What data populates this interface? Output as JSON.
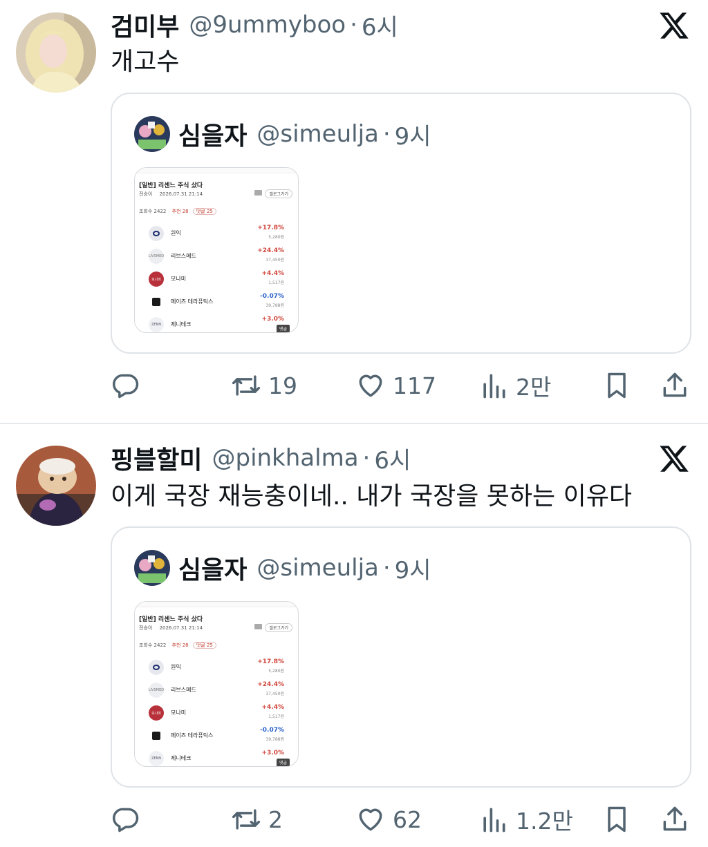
{
  "tweets": [
    {
      "name": "검미부",
      "handle": "@9ummyboo",
      "separator": "·",
      "time": "6시",
      "text": "개고수",
      "avatar_icon": "user-avatar-blonde",
      "quote": {
        "name": "심을자",
        "handle": "@simeulja",
        "separator": "·",
        "time": "9시",
        "avatar_icon": "cartoon-avatar",
        "screenshot": {
          "title": "[일반] 리센느 주식 샀다",
          "author": "전승이",
          "date": "2026.07.31 21:14",
          "copy_button": "갤로그가기",
          "views_label": "조회수 2422",
          "recommend_label": "추천 28",
          "comments_label": "댓글 25",
          "stocks": [
            {
              "name": "원익",
              "change": "+17.8%",
              "price": "5,280원",
              "dir": "up",
              "logo_color": "#1e2f6e",
              "logo_text": ""
            },
            {
              "name": "리브스메드",
              "change": "+24.4%",
              "price": "37,450원",
              "dir": "up",
              "logo_color": "#c9ced6",
              "logo_text": "LIVSMED"
            },
            {
              "name": "모나미",
              "change": "+4.4%",
              "price": "1,517원",
              "dir": "up",
              "logo_color": "#b8313a",
              "logo_text": "모나미"
            },
            {
              "name": "메이즈 테라퓨틱스",
              "change": "-0.07%",
              "price": "39,788원",
              "dir": "down",
              "logo_color": "#1a1a1a",
              "logo_text": ""
            },
            {
              "name": "제니테크",
              "change": "+3.0%",
              "price": "",
              "dir": "up",
              "logo_color": "#dfe3ea",
              "logo_text": "ZENN"
            }
          ],
          "badge": "댓글"
        }
      },
      "actions": {
        "reply": "",
        "retweet": "19",
        "like": "117",
        "views": "2만"
      }
    },
    {
      "name": "핑블할미",
      "handle": "@pinkhalma",
      "separator": "·",
      "time": "6시",
      "text": "이게 국장 재능충이네.. 내가 국장을 못하는 이유다",
      "avatar_icon": "grandma-avatar",
      "quote": {
        "name": "심을자",
        "handle": "@simeulja",
        "separator": "·",
        "time": "9시",
        "avatar_icon": "cartoon-avatar",
        "screenshot": {
          "title": "[일반] 리센느 주식 샀다",
          "author": "전승이",
          "date": "2026.07.31 21:14",
          "copy_button": "갤로그가기",
          "views_label": "조회수 2422",
          "recommend_label": "추천 28",
          "comments_label": "댓글 25",
          "stocks": [
            {
              "name": "원익",
              "change": "+17.8%",
              "price": "5,280원",
              "dir": "up",
              "logo_color": "#1e2f6e",
              "logo_text": ""
            },
            {
              "name": "리브스메드",
              "change": "+24.4%",
              "price": "37,450원",
              "dir": "up",
              "logo_color": "#c9ced6",
              "logo_text": "LIVSMED"
            },
            {
              "name": "모나미",
              "change": "+4.4%",
              "price": "1,517원",
              "dir": "up",
              "logo_color": "#b8313a",
              "logo_text": "모나미"
            },
            {
              "name": "메이즈 테라퓨틱스",
              "change": "-0.07%",
              "price": "39,788원",
              "dir": "down",
              "logo_color": "#1a1a1a",
              "logo_text": ""
            },
            {
              "name": "제니테크",
              "change": "+3.0%",
              "price": "",
              "dir": "up",
              "logo_color": "#dfe3ea",
              "logo_text": "ZENN"
            }
          ],
          "badge": "댓글"
        }
      },
      "actions": {
        "reply": "",
        "retweet": "2",
        "like": "62",
        "views": "1.2만"
      }
    }
  ],
  "colors": {
    "text": "#0f1419",
    "secondary": "#536471",
    "border": "#dfe3e7",
    "up": "#d0463b",
    "down": "#2a62c9"
  }
}
